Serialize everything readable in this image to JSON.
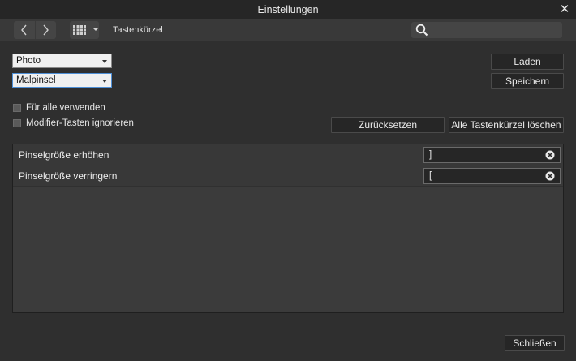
{
  "window": {
    "title": "Einstellungen",
    "close_glyph": "✕"
  },
  "toolbar": {
    "nav_back_icon": "chevron-left-icon",
    "nav_forward_icon": "chevron-right-icon",
    "grid_icon": "grid-icon",
    "title": "Tastenkürzel",
    "search": {
      "value": "",
      "placeholder": ""
    }
  },
  "selects": {
    "app": {
      "value": "Photo"
    },
    "category": {
      "value": "Malpinsel"
    }
  },
  "buttons": {
    "load": "Laden",
    "save": "Speichern",
    "reset": "Zurücksetzen",
    "clear_all": "Alle Tastenkürzel löschen",
    "close": "Schließen"
  },
  "options": {
    "apply_to_all": {
      "label": "Für alle verwenden",
      "checked": false
    },
    "ignore_modifiers": {
      "label": "Modifier-Tasten ignorieren",
      "checked": false
    }
  },
  "shortcuts": [
    {
      "label": "Pinselgröße erhöhen",
      "key": "]"
    },
    {
      "label": "Pinselgröße verringern",
      "key": "["
    }
  ],
  "colors": {
    "background": "#2f2f2f",
    "titlebar": "#262626",
    "toolbar": "#393939",
    "focus_accent": "#4e8fd6"
  }
}
